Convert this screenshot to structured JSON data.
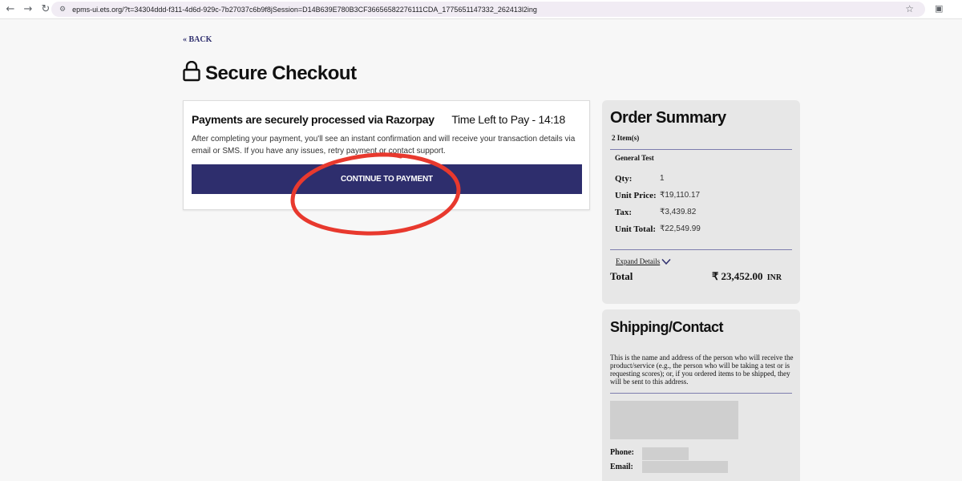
{
  "browser": {
    "url": "epms-ui.ets.org/?t=34304ddd-f311-4d6d-929c-7b27037c6b9f8jSession=D14B639E780B3CF36656582276111CDA_1775651147332_262413l2ing",
    "back_icon": "arrow-left-icon",
    "forward_icon": "arrow-right-icon",
    "reload_icon": "reload-icon"
  },
  "nav": {
    "back_label": "« BACK"
  },
  "page": {
    "title": "Secure Checkout"
  },
  "payment": {
    "heading": "Payments are securely processed via Razorpay",
    "timer": "Time Left to Pay - 14:18",
    "description": "After completing your payment, you'll see an instant confirmation and will receive your transaction details via email or SMS. If you have any issues, retry payment or contact support.",
    "button_label": "CONTINUE TO PAYMENT",
    "button_color": "#2e2e6d"
  },
  "summary": {
    "title": "Order Summary",
    "items_count": "2 Item(s)",
    "product_name": "General Test",
    "lines": [
      {
        "label": "Qty:",
        "value": "1"
      },
      {
        "label": "Unit Price:",
        "value": "₹19,110.17"
      },
      {
        "label": "Tax:",
        "value": "₹3,439.82"
      },
      {
        "label": "Unit Total:",
        "value": "₹22,549.99"
      }
    ],
    "expand_label": "Expand Details",
    "total_label": "Total",
    "total_value": "₹ 23,452.00",
    "total_currency": "INR"
  },
  "shipping": {
    "title": "Shipping/Contact",
    "description": "This is the name and address of the person who will receive the product/service (e.g., the person who will be taking a test or is requesting scores); or, if you ordered items to be shipped, they will be sent to this address.",
    "phone_label": "Phone:",
    "email_label": "Email:"
  },
  "annotation_color": "#e8392e"
}
